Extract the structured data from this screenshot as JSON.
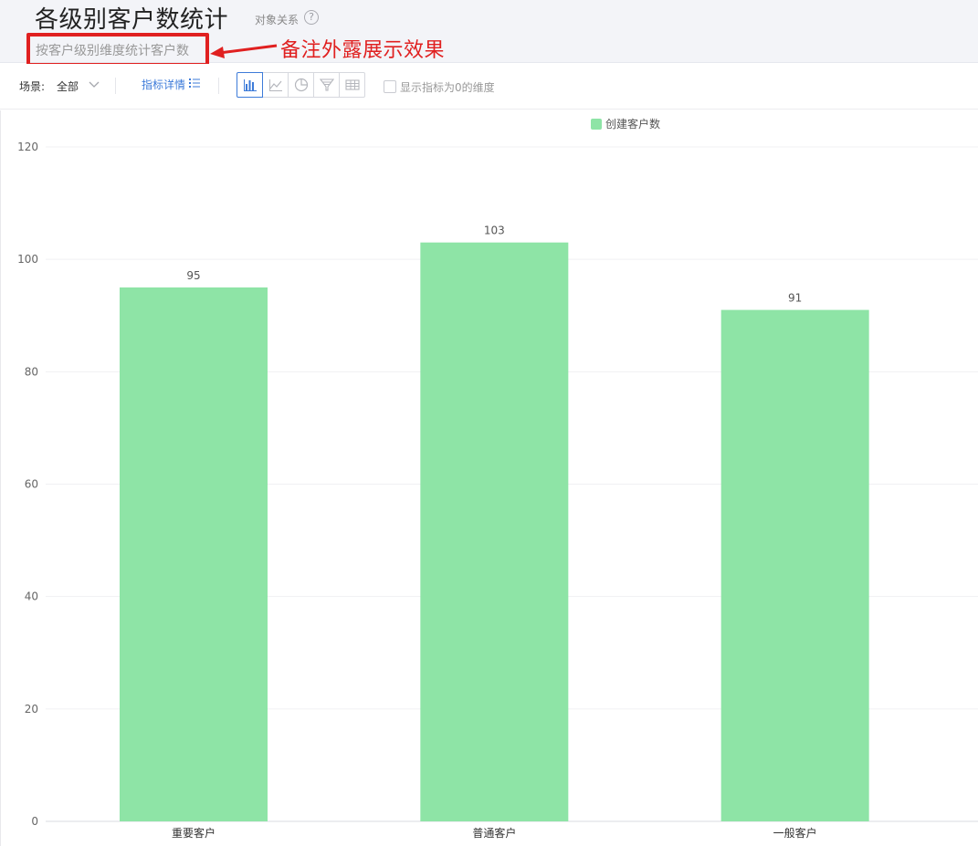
{
  "header": {
    "title": "各级别客户数统计",
    "relation_label": "对象关系",
    "help_icon": "?",
    "subtitle": "按客户级别维度统计客户数",
    "annotation": "备注外露展示效果"
  },
  "toolbar": {
    "scene_label": "场景:",
    "scene_value": "全部",
    "detail_link": "指标详情",
    "chart_types": [
      "bar-chart-icon",
      "line-chart-icon",
      "pie-chart-icon",
      "funnel-chart-icon",
      "table-icon"
    ],
    "active_chart_type": "bar-chart-icon",
    "show_zero_label": "显示指标为0的维度",
    "show_zero_checked": false
  },
  "colors": {
    "bar": "#8ee4a6",
    "accent": "#3d7bd9",
    "annotation": "#e02020"
  },
  "chart_data": {
    "type": "bar",
    "categories": [
      "重要客户",
      "普通客户",
      "一般客户"
    ],
    "series": [
      {
        "name": "创建客户数",
        "values": [
          95,
          103,
          91
        ]
      }
    ],
    "ylim": [
      0,
      120
    ],
    "yticks": [
      0,
      20,
      40,
      60,
      80,
      100,
      120
    ],
    "grid": true,
    "legend": "top-center",
    "data_labels": true
  }
}
